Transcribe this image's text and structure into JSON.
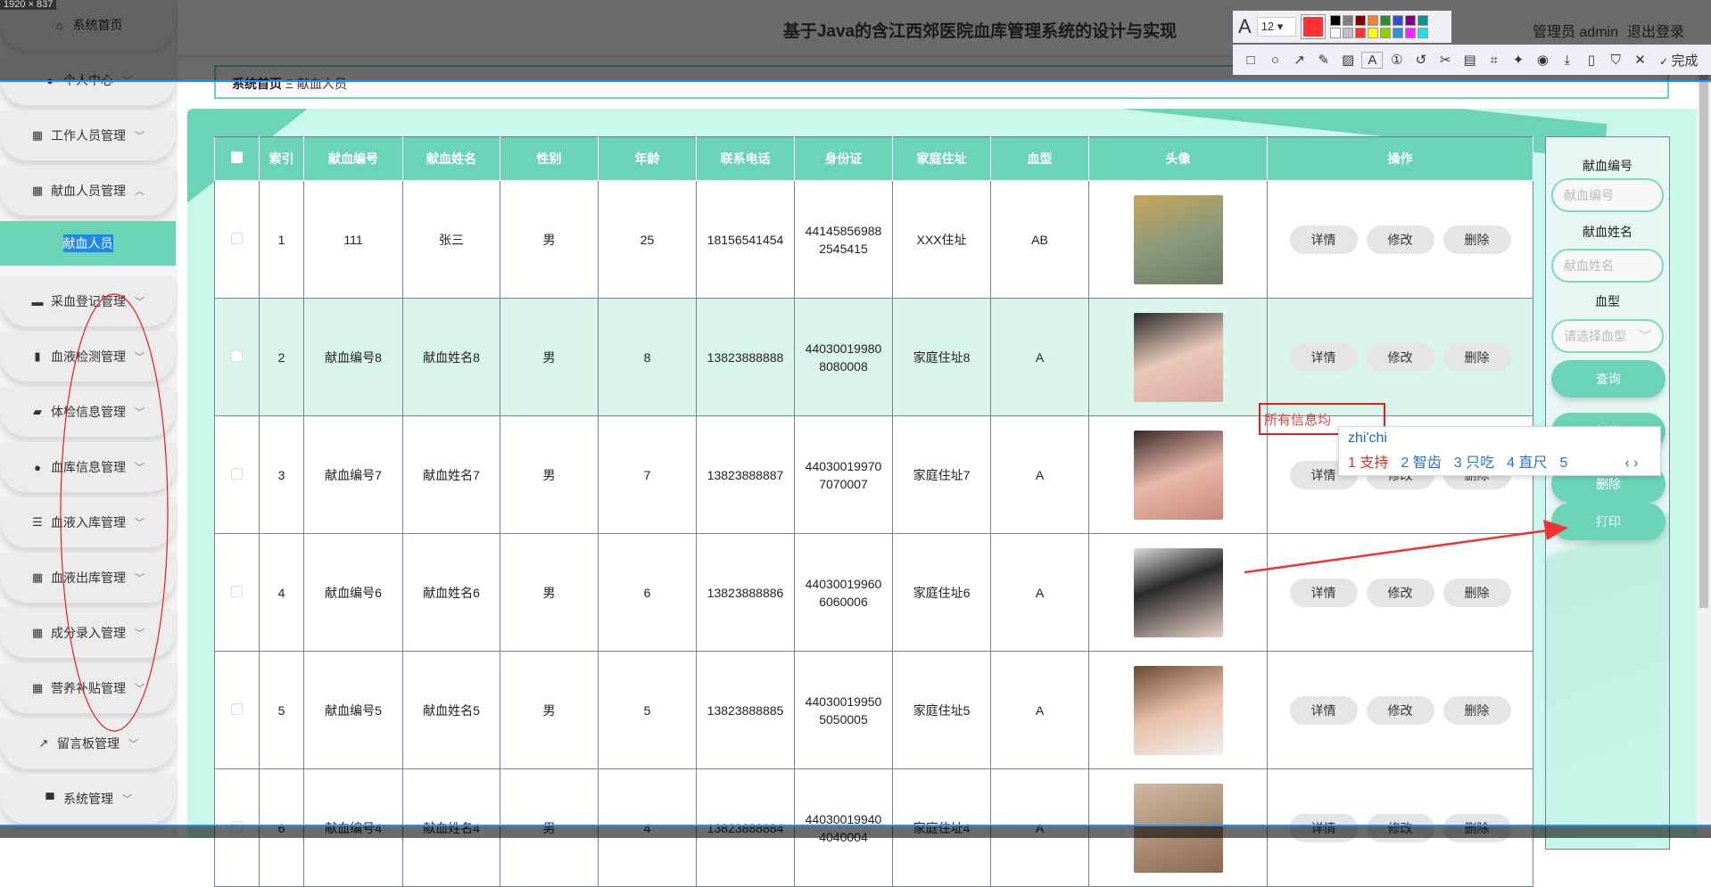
{
  "header": {
    "title": "基于Java的含江西郊医院血库管理系统的设计与实现",
    "user": "管理员 admin",
    "logout": "退出登录"
  },
  "sidebar": {
    "items": [
      {
        "label": "系统首页",
        "icon": "home-icon",
        "chev": ""
      },
      {
        "label": "个人中心",
        "icon": "user-icon",
        "chev": "﹀"
      },
      {
        "label": "工作人员管理",
        "icon": "grid-icon",
        "chev": "﹀"
      },
      {
        "label": "献血人员管理",
        "icon": "grid-icon",
        "chev": "︿"
      },
      {
        "label": "献血人员",
        "icon": "",
        "chev": "",
        "sub": true
      },
      {
        "label": "采血登记管理",
        "icon": "chat-icon",
        "chev": "﹀"
      },
      {
        "label": "血液检测管理",
        "icon": "bar-chart-icon",
        "chev": "﹀"
      },
      {
        "label": "体检信息管理",
        "icon": "briefcase-icon",
        "chev": "﹀"
      },
      {
        "label": "血库信息管理",
        "icon": "user-icon",
        "chev": "﹀"
      },
      {
        "label": "血液入库管理",
        "icon": "list-icon",
        "chev": "﹀"
      },
      {
        "label": "血液出库管理",
        "icon": "grid-icon",
        "chev": "﹀"
      },
      {
        "label": "成分录入管理",
        "icon": "grid-icon",
        "chev": "﹀"
      },
      {
        "label": "营养补贴管理",
        "icon": "grid-icon",
        "chev": "﹀"
      },
      {
        "label": "留言板管理",
        "icon": "line-chart-icon",
        "chev": "﹀"
      },
      {
        "label": "系统管理",
        "icon": "printer-icon",
        "chev": "﹀"
      }
    ]
  },
  "breadcrumb": {
    "home": "系统首页",
    "sep": "Ξ",
    "current": "献血人员"
  },
  "table": {
    "columns": [
      "索引",
      "献血编号",
      "献血姓名",
      "性别",
      "年龄",
      "联系电话",
      "身份证",
      "家庭住址",
      "血型",
      "头像",
      "操作"
    ],
    "actions": [
      "详情",
      "修改",
      "删除"
    ],
    "rows": [
      [
        "1",
        "111",
        "张三",
        "男",
        "25",
        "18156541454",
        "441458569882545415",
        "XXX住址",
        "AB"
      ],
      [
        "2",
        "献血编号8",
        "献血姓名8",
        "男",
        "8",
        "13823888888",
        "440300199808080008",
        "家庭住址8",
        "A"
      ],
      [
        "3",
        "献血编号7",
        "献血姓名7",
        "男",
        "7",
        "13823888887",
        "440300199707070007",
        "家庭住址7",
        "A"
      ],
      [
        "4",
        "献血编号6",
        "献血姓名6",
        "男",
        "6",
        "13823888886",
        "440300199606060006",
        "家庭住址6",
        "A"
      ],
      [
        "5",
        "献血编号5",
        "献血姓名5",
        "男",
        "5",
        "13823888885",
        "440300199505050005",
        "家庭住址5",
        "A"
      ],
      [
        "6",
        "献血编号4",
        "献血姓名4",
        "男",
        "4",
        "13823888884",
        "440300199404040004",
        "家庭住址4",
        "A"
      ]
    ]
  },
  "search": {
    "label_no": "献血编号",
    "ph_no": "献血编号",
    "label_name": "献血姓名",
    "ph_name": "献血姓名",
    "label_type": "血型",
    "ph_type": "请选择血型",
    "query": "查询",
    "add": "新增",
    "delete": "删除",
    "print": "打印"
  },
  "overlay": {
    "size_label": "1920 × 837",
    "font_size": "12",
    "done": "完成",
    "annotation": "所有信息均",
    "ime_input": "zhi'chi",
    "ime_candidates": [
      "1 支持",
      "2 智齿",
      "3 只吃",
      "4 直尺",
      "5"
    ],
    "ime_nav": "‹ ›"
  },
  "colors": {
    "accent": "#6ad4b4",
    "annotation": "#ff3333"
  }
}
